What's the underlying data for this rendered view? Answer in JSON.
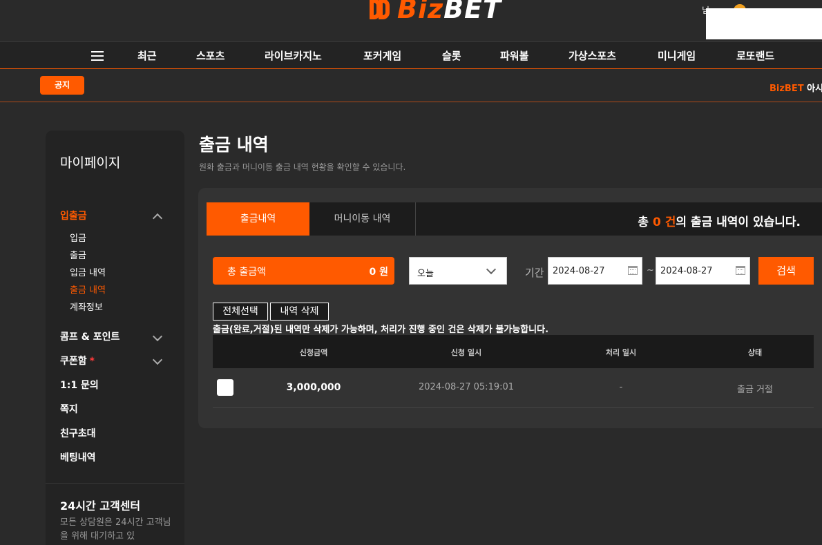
{
  "header": {
    "logo_biz": "Biz",
    "logo_bet": "BET",
    "user_fragment": "님"
  },
  "nav": {
    "items": [
      "최근",
      "스포츠",
      "라이브카지노",
      "포커게임",
      "슬롯",
      "파워볼",
      "가상스포츠",
      "미니게임",
      "로또랜드"
    ]
  },
  "notice": {
    "badge": "공지",
    "ticker_brand": "BizBET",
    "ticker_text": " 아시아"
  },
  "sidebar": {
    "title": "마이페이지",
    "deposit_group": "입출금",
    "deposit_items": [
      "입금",
      "출금",
      "입금 내역",
      "출금 내역",
      "계좌정보"
    ],
    "comp_point": "콤프 & 포인트",
    "coupon": "쿠폰함",
    "coupon_mark": "*",
    "inquiry": "1:1 문의",
    "message": "쪽지",
    "invite": "친구초대",
    "betting": "베팅내역",
    "cs_title": "24시간 고객센터",
    "cs_text": "모든 상담원은 24시간 고객님을 위해 대기하고 있"
  },
  "main": {
    "title": "출금 내역",
    "desc": "원화 출금과 머니이동 출금 내역 현황을 확인할 수 있습니다.",
    "tabs": [
      "출금내역",
      "머니이동 내역"
    ],
    "count_prefix": "총 ",
    "count_num": "0 건",
    "count_suffix": "의 출금 내역이 있습니다.",
    "total_label": "총 출금액",
    "total_value": "0 원",
    "period_select": "오늘",
    "period_label": "기간",
    "date_from": "2024-08-27",
    "date_sep": "~",
    "date_to": "2024-08-27",
    "search": "검색",
    "select_all": "전체선택",
    "delete": "내역 삭제",
    "warning": "출금(완료,거절)된 내역만 삭제가 가능하며, 처리가 진행 중인 건은 삭제가 불가능합니다.",
    "table": {
      "headers": [
        "신청금액",
        "신청 일시",
        "처리 일시",
        "상태"
      ],
      "rows": [
        {
          "amount": "3,000,000",
          "requested": "2024-08-27 05:19:01",
          "processed": "-",
          "status": "출금 거절"
        }
      ]
    }
  },
  "colors": {
    "accent": "#ff5a00",
    "bg": "#2a2a2a",
    "panel": "#333333"
  }
}
